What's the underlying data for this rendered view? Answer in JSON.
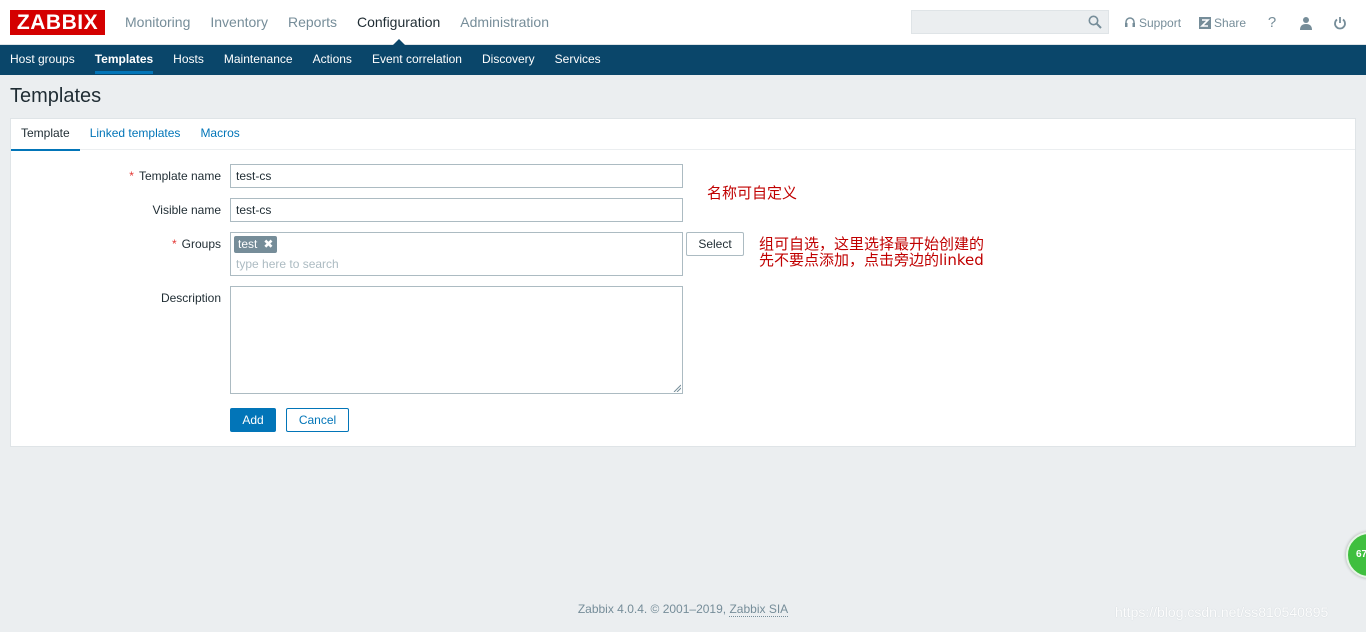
{
  "header": {
    "logo": "ZABBIX",
    "main_menu": [
      "Monitoring",
      "Inventory",
      "Reports",
      "Configuration",
      "Administration"
    ],
    "active_menu": "Configuration",
    "search": {
      "value": "",
      "placeholder": ""
    },
    "support_label": "Support",
    "share_label": "Share",
    "help_label": "?"
  },
  "sub_menu": {
    "items": [
      "Host groups",
      "Templates",
      "Hosts",
      "Maintenance",
      "Actions",
      "Event correlation",
      "Discovery",
      "Services"
    ],
    "active": "Templates"
  },
  "page": {
    "title": "Templates"
  },
  "tabs": [
    "Template",
    "Linked templates",
    "Macros"
  ],
  "form": {
    "template_name": {
      "label": "Template name",
      "value": "test-cs",
      "required": true
    },
    "visible_name": {
      "label": "Visible name",
      "value": "test-cs"
    },
    "groups": {
      "label": "Groups",
      "tag": "test",
      "placeholder": "type here to search",
      "select_label": "Select",
      "required": true
    },
    "description": {
      "label": "Description",
      "value": ""
    },
    "add_label": "Add",
    "cancel_label": "Cancel"
  },
  "annotations": {
    "name_note": "名称可自定义",
    "group_note_line1": "组可自选，这里选择最开始创建的",
    "group_note_line2": "先不要点添加，点击旁边的linked"
  },
  "footer": {
    "text": "Zabbix 4.0.4. © 2001–2019,",
    "link": "Zabbix SIA",
    "watermark": "https://blog.csdn.net/ss810540895",
    "widget_value": "67"
  },
  "colors": {
    "logo_bg": "#d40000",
    "sub_nav_bg": "#0a466a",
    "accent": "#0275b8",
    "annotation": "#c00000"
  }
}
